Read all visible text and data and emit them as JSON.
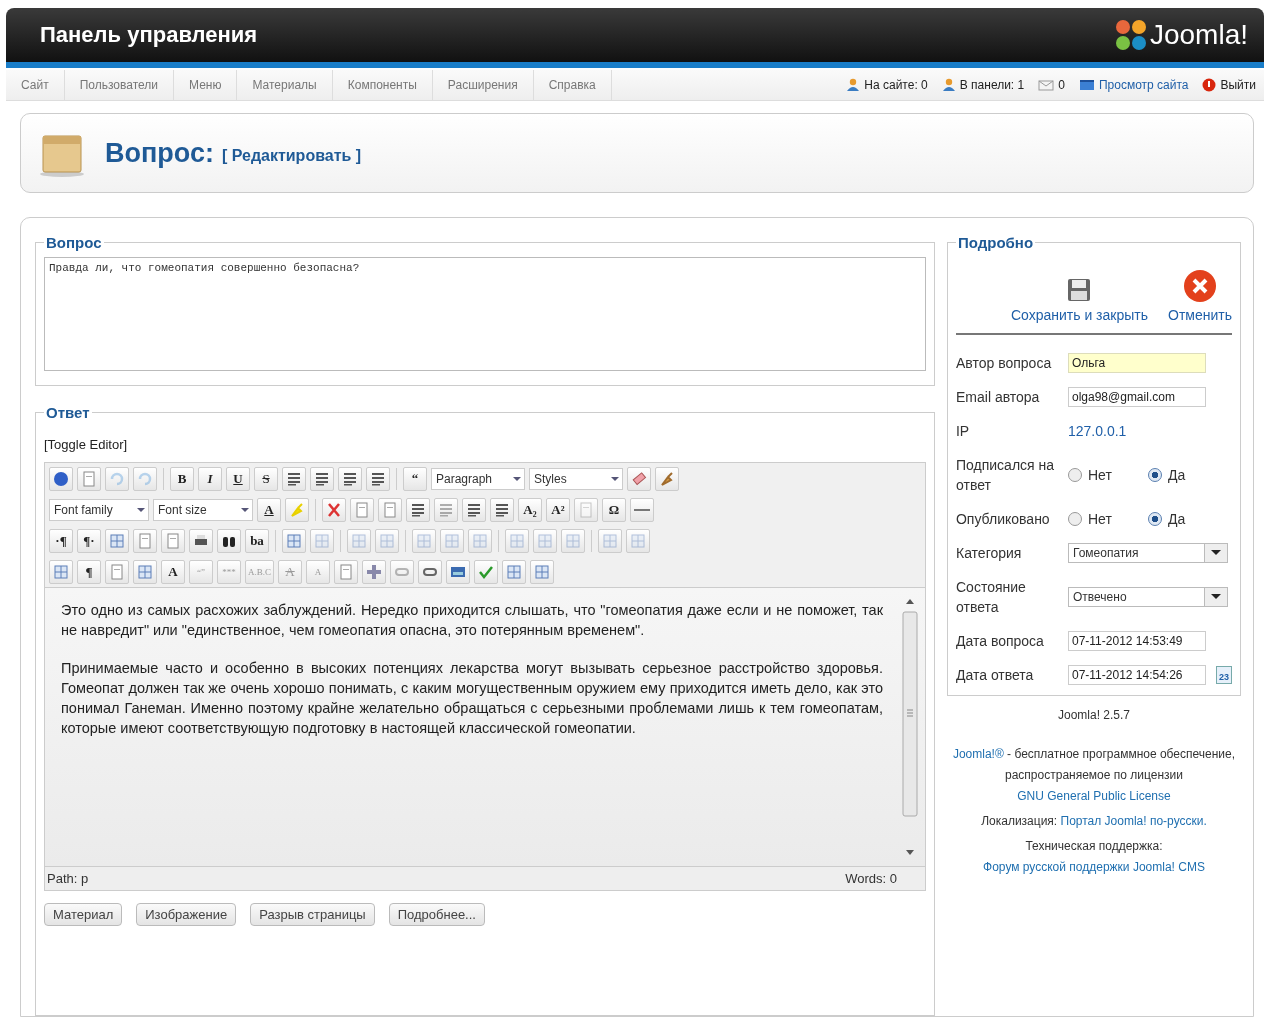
{
  "header": {
    "title": "Панель управления",
    "logo": "Joomla!"
  },
  "menu": [
    {
      "label": "Сайт"
    },
    {
      "label": "Пользователи"
    },
    {
      "label": "Меню"
    },
    {
      "label": "Материалы"
    },
    {
      "label": "Компоненты"
    },
    {
      "label": "Расширения"
    },
    {
      "label": "Справка"
    }
  ],
  "status": [
    {
      "kind": "users",
      "text": "На сайте: 0"
    },
    {
      "kind": "users",
      "text": "В панели: 1"
    },
    {
      "kind": "mail",
      "text": "0"
    },
    {
      "kind": "view",
      "text": "Просмотр сайта",
      "link": true
    },
    {
      "kind": "logout",
      "text": "Выйти"
    }
  ],
  "page_title": {
    "title": "Вопрос:",
    "action": "[ Редактировать ]"
  },
  "question": {
    "legend": "Вопрос",
    "value": "Правда ли, что гомеопатия совершенно безопасна?"
  },
  "answer": {
    "legend": "Ответ",
    "toggle": "[Toggle Editor]",
    "toolbar": [
      [
        {
          "kind": "icon",
          "disabled": false
        },
        {
          "kind": "icon",
          "disabled": false
        },
        {
          "kind": "icon",
          "disabled": true
        },
        {
          "kind": "icon",
          "disabled": true
        },
        {
          "kind": "sep"
        },
        {
          "kind": "glyph",
          "text": "B",
          "disabled": false
        },
        {
          "kind": "glyph",
          "text": "I",
          "disabled": false
        },
        {
          "kind": "glyph",
          "text": "U",
          "disabled": false
        },
        {
          "kind": "glyph",
          "text": "S",
          "disabled": false
        },
        {
          "kind": "icon",
          "disabled": false
        },
        {
          "kind": "icon",
          "disabled": false
        },
        {
          "kind": "icon",
          "disabled": false
        },
        {
          "kind": "icon",
          "disabled": false
        },
        {
          "kind": "sep"
        },
        {
          "kind": "glyph",
          "text": "“",
          "disabled": false
        },
        {
          "kind": "select",
          "value": "Paragraph"
        },
        {
          "kind": "select",
          "value": "Styles"
        },
        {
          "kind": "icon",
          "disabled": false
        },
        {
          "kind": "icon",
          "disabled": false
        }
      ],
      [
        {
          "kind": "select",
          "value": "Font family"
        },
        {
          "kind": "select",
          "value": "Font size"
        },
        {
          "kind": "glyph",
          "text": "A",
          "disabled": false
        },
        {
          "kind": "icon",
          "disabled": false
        },
        {
          "kind": "sep"
        },
        {
          "kind": "icon",
          "disabled": false
        },
        {
          "kind": "icon",
          "disabled": false
        },
        {
          "kind": "icon",
          "disabled": false
        },
        {
          "kind": "icon",
          "disabled": false
        },
        {
          "kind": "icon",
          "disabled": true
        },
        {
          "kind": "icon",
          "disabled": false
        },
        {
          "kind": "icon",
          "disabled": false
        },
        {
          "kind": "glyph",
          "text": "A₂",
          "disabled": false
        },
        {
          "kind": "glyph",
          "text": "A²",
          "disabled": false
        },
        {
          "kind": "icon",
          "disabled": true
        },
        {
          "kind": "glyph",
          "text": "Ω",
          "disabled": false
        },
        {
          "kind": "icon",
          "disabled": false
        }
      ],
      [
        {
          "kind": "glyph",
          "text": "·¶",
          "disabled": false
        },
        {
          "kind": "glyph",
          "text": "¶·",
          "disabled": false
        },
        {
          "kind": "icon",
          "disabled": false
        },
        {
          "kind": "icon",
          "disabled": false
        },
        {
          "kind": "icon",
          "disabled": false
        },
        {
          "kind": "icon",
          "disabled": false
        },
        {
          "kind": "icon",
          "disabled": false
        },
        {
          "kind": "glyph",
          "text": "ba",
          "disabled": false
        },
        {
          "kind": "sep"
        },
        {
          "kind": "icon",
          "disabled": false
        },
        {
          "kind": "icon",
          "disabled": true
        },
        {
          "kind": "sep"
        },
        {
          "kind": "icon",
          "disabled": true
        },
        {
          "kind": "icon",
          "disabled": true
        },
        {
          "kind": "sep"
        },
        {
          "kind": "icon",
          "disabled": true
        },
        {
          "kind": "icon",
          "disabled": true
        },
        {
          "kind": "icon",
          "disabled": true
        },
        {
          "kind": "sep"
        },
        {
          "kind": "icon",
          "disabled": true
        },
        {
          "kind": "icon",
          "disabled": true
        },
        {
          "kind": "icon",
          "disabled": true
        },
        {
          "kind": "sep"
        },
        {
          "kind": "icon",
          "disabled": true
        },
        {
          "kind": "icon",
          "disabled": true
        }
      ],
      [
        {
          "kind": "icon",
          "disabled": false
        },
        {
          "kind": "glyph",
          "text": "¶",
          "disabled": false
        },
        {
          "kind": "icon",
          "disabled": false
        },
        {
          "kind": "icon",
          "disabled": false
        },
        {
          "kind": "glyph",
          "text": "A",
          "disabled": false
        },
        {
          "kind": "glyph",
          "text": "“”",
          "disabled": true
        },
        {
          "kind": "glyph",
          "text": "***",
          "disabled": true
        },
        {
          "kind": "glyph",
          "text": "A.B.C",
          "disabled": true
        },
        {
          "kind": "glyph",
          "text": "A",
          "disabled": true
        },
        {
          "kind": "glyph",
          "text": "A",
          "disabled": true
        },
        {
          "kind": "icon",
          "disabled": false
        },
        {
          "kind": "icon",
          "disabled": false
        },
        {
          "kind": "icon",
          "disabled": true
        },
        {
          "kind": "icon",
          "disabled": false
        },
        {
          "kind": "icon",
          "disabled": false
        },
        {
          "kind": "icon",
          "disabled": false
        },
        {
          "kind": "icon",
          "disabled": false
        },
        {
          "kind": "icon",
          "disabled": false
        }
      ]
    ],
    "paragraphs": [
      "Это одно из самых расхожих заблуждений. Нередко приходится слышать, что \"гомеопатия даже если и не поможет, так не навредит\" или \"единственное, чем гомеопатия опасна, это потерянным временем\".",
      "Принимаемые часто и особенно в высоких потенциях лекарства могут вызывать серьезное расстройство здоровья. Гомеопат должен так же очень хорошо понимать, с каким могущественным оружием ему приходится иметь дело, как это понимал Ганеман. Именно поэтому крайне желательно обращаться с серьезными проблемами лишь к тем гомеопатам, которые имеют соответствующую подготовку в настоящей классической гомеопатии."
    ],
    "path": "Path:  p",
    "words": "Words: 0",
    "buttons": [
      {
        "label": "Материал"
      },
      {
        "label": "Изображение"
      },
      {
        "label": "Разрыв страницы"
      },
      {
        "label": "Подробнее..."
      }
    ]
  },
  "details": {
    "legend": "Подробно",
    "actions": [
      {
        "kind": "save",
        "label": "Сохранить и закрыть"
      },
      {
        "kind": "cancel",
        "label": "Отменить"
      }
    ],
    "fields": [
      {
        "kind": "text",
        "label": "Автор вопроса",
        "value": "Ольга",
        "focused": true
      },
      {
        "kind": "text",
        "label": "Email автора",
        "value": "olga98@gmail.com",
        "focused": false
      },
      {
        "kind": "static",
        "label": "IP",
        "value": "127.0.0.1"
      },
      {
        "kind": "radio",
        "label": "Подписался на ответ",
        "options": [
          {
            "label": "Нет",
            "selected": false
          },
          {
            "label": "Да",
            "selected": true
          }
        ]
      },
      {
        "kind": "radio",
        "label": "Опубликовано",
        "options": [
          {
            "label": "Нет",
            "selected": false
          },
          {
            "label": "Да",
            "selected": true
          }
        ]
      },
      {
        "kind": "select",
        "label": "Категория",
        "value": "Гомеопатия"
      },
      {
        "kind": "select",
        "label": "Состояние ответа",
        "value": "Отвечено"
      },
      {
        "kind": "text",
        "label": "Дата вопроса",
        "value": "07-11-2012 14:53:49",
        "focused": false
      },
      {
        "kind": "date",
        "label": "Дата ответа",
        "value": "07-11-2012 14:54:26",
        "calendar": "23"
      }
    ]
  },
  "footer": {
    "version": "Joomla! 2.5.7",
    "lines": [
      "**Joomla!®** - бесплатное программное обеспечение, распространяемое по лицензии **GNU General Public License**",
      "Локализация: **Портал Joomla! по-русски.**",
      "Техническая поддержка: **Форум русской поддержки Joomla! CMS**"
    ]
  }
}
